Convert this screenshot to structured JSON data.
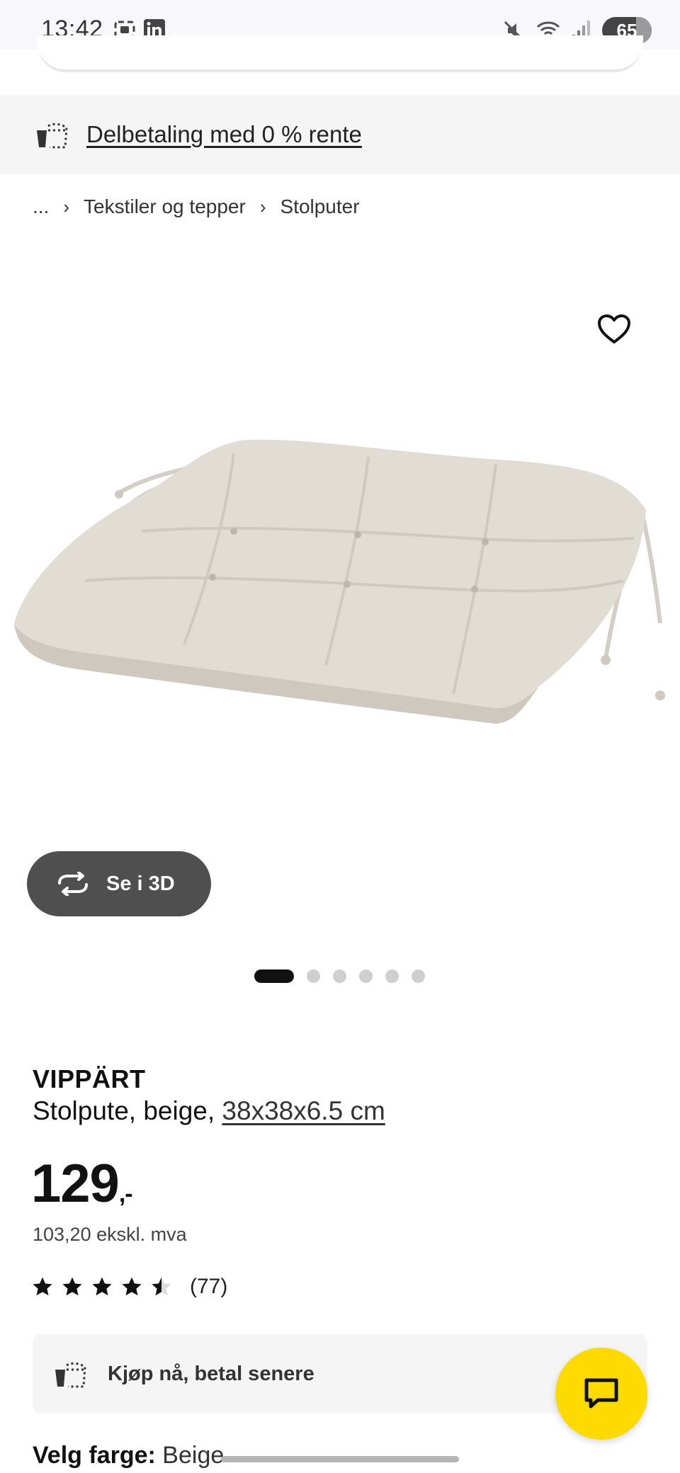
{
  "status_bar": {
    "time": "13:42",
    "battery": "65",
    "icons": [
      "screenshot-icon",
      "linkedin-icon",
      "mute-icon",
      "wifi-icon",
      "signal-icon",
      "battery-icon"
    ]
  },
  "promo": {
    "link": "Delbetaling med 0 % rente",
    "icon": "installment-icon"
  },
  "breadcrumb": {
    "items": [
      "...",
      "Tekstiler og tepper",
      "Stolputer"
    ]
  },
  "gallery": {
    "favorite_icon": "heart-icon",
    "view_3d_label": "Se i 3D",
    "image_count": 6,
    "active_index": 0
  },
  "product": {
    "name": "VIPPÄRT",
    "description": "Stolpute, beige, ",
    "size": "38x38x6.5 cm",
    "price": "129",
    "price_suffix": ",-",
    "price_ex_vat": "103,20 ekskl. mva",
    "rating": 4.5,
    "rating_max": 5,
    "review_count": "(77)"
  },
  "bnpl": {
    "label": "Kjøp nå, betal senere"
  },
  "color": {
    "label": "Velg farge:",
    "value": "Beige"
  },
  "colors": {
    "accent_yellow": "#fedb00",
    "dark_button": "#4f4f4f",
    "panel_bg": "#f5f5f5"
  }
}
